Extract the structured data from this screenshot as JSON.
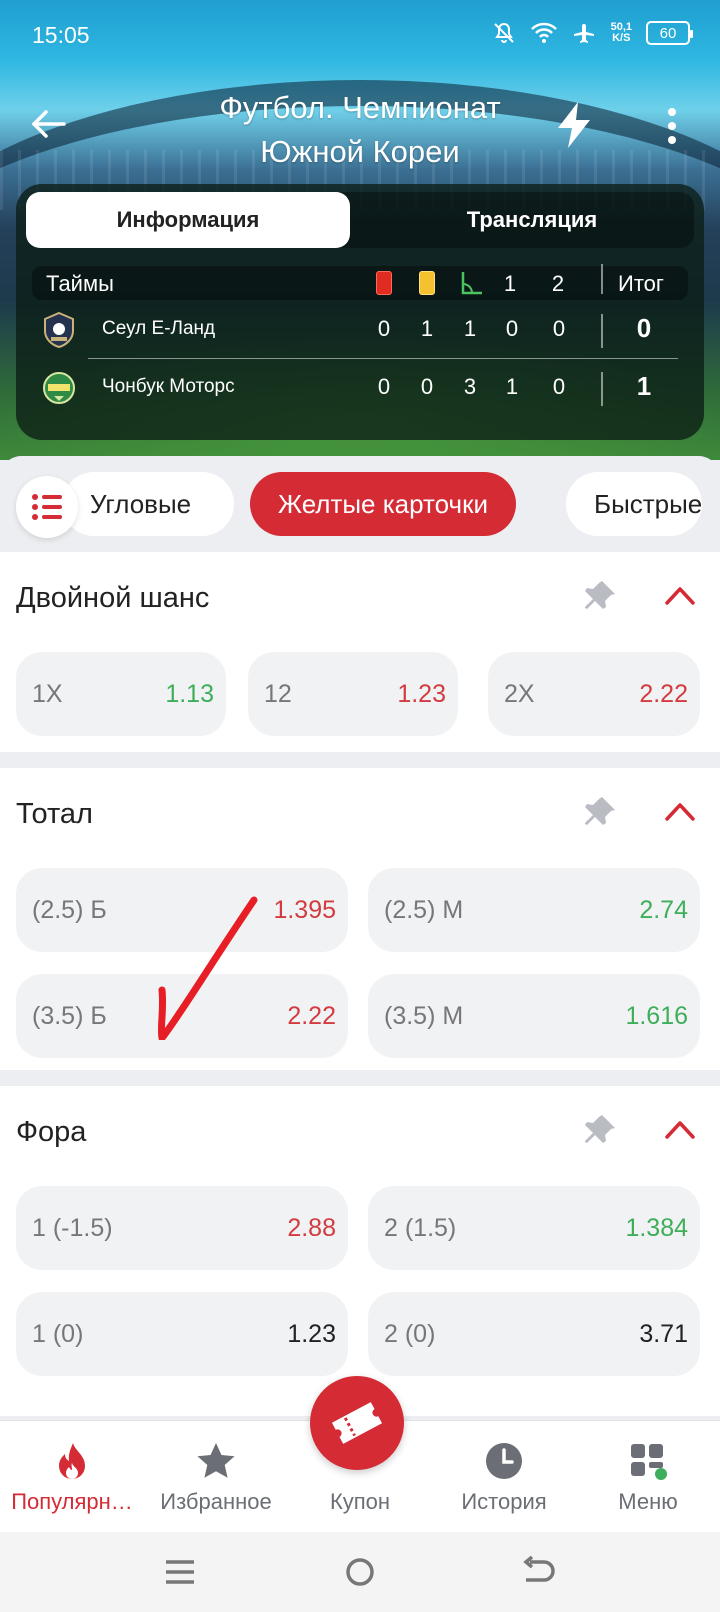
{
  "status_bar": {
    "time": "15:05",
    "net_speed_value": "50,1",
    "net_speed_unit": "K/S",
    "battery": "60"
  },
  "header": {
    "title_line1": "Футбол. Чемпионат",
    "title_line2": "Южной Кореи"
  },
  "tabs": [
    {
      "label": "Информация",
      "active": true
    },
    {
      "label": "Трансляция",
      "active": false
    }
  ],
  "scoreboard": {
    "periods_label": "Таймы",
    "period_headers": [
      "1",
      "2"
    ],
    "total_label": "Итог",
    "teams": [
      {
        "name": "Сеул Е-Ланд",
        "red": "0",
        "yellow": "1",
        "corners": "1",
        "p1": "0",
        "p2": "0",
        "total": "0"
      },
      {
        "name": "Чонбук Моторс",
        "red": "0",
        "yellow": "0",
        "corners": "3",
        "p1": "1",
        "p2": "0",
        "total": "1"
      }
    ]
  },
  "chips": [
    {
      "label": "Угловые",
      "active": false
    },
    {
      "label": "Желтые карточки",
      "active": true
    },
    {
      "label": "Быстрые",
      "active": false
    }
  ],
  "markets": {
    "double_chance": {
      "title": "Двойной шанс",
      "odds": [
        {
          "name": "1X",
          "value": "1.13",
          "color": "#3fae5a"
        },
        {
          "name": "12",
          "value": "1.23",
          "color": "#d23b3f"
        },
        {
          "name": "2X",
          "value": "2.22",
          "color": "#d23b3f"
        }
      ]
    },
    "total": {
      "title": "Тотал",
      "odds": [
        {
          "name": "(2.5) Б",
          "value": "1.395",
          "color": "#d23b3f"
        },
        {
          "name": "(2.5) М",
          "value": "2.74",
          "color": "#3fae5a"
        },
        {
          "name": "(3.5) Б",
          "value": "2.22",
          "color": "#d23b3f"
        },
        {
          "name": "(3.5) М",
          "value": "1.616",
          "color": "#3fae5a"
        }
      ]
    },
    "handicap": {
      "title": "Фора",
      "odds": [
        {
          "name": "1 (-1.5)",
          "value": "2.88",
          "color": "#d23b3f"
        },
        {
          "name": "2 (1.5)",
          "value": "1.384",
          "color": "#3fae5a"
        },
        {
          "name": "1 (0)",
          "value": "1.23",
          "color": "#222222"
        },
        {
          "name": "2 (0)",
          "value": "3.71",
          "color": "#222222"
        }
      ]
    }
  },
  "bottom_nav": [
    {
      "label": "Популярн…",
      "icon": "fire-icon",
      "active": true
    },
    {
      "label": "Избранное",
      "icon": "star-icon",
      "active": false
    },
    {
      "label": "Купон",
      "icon": "ticket-icon",
      "active": false
    },
    {
      "label": "История",
      "icon": "clock-icon",
      "active": false
    },
    {
      "label": "Меню",
      "icon": "grid-icon",
      "active": false
    }
  ],
  "colors": {
    "accent": "#d42b35",
    "odds_up": "#3fae5a",
    "odds_down": "#d23b3f"
  }
}
